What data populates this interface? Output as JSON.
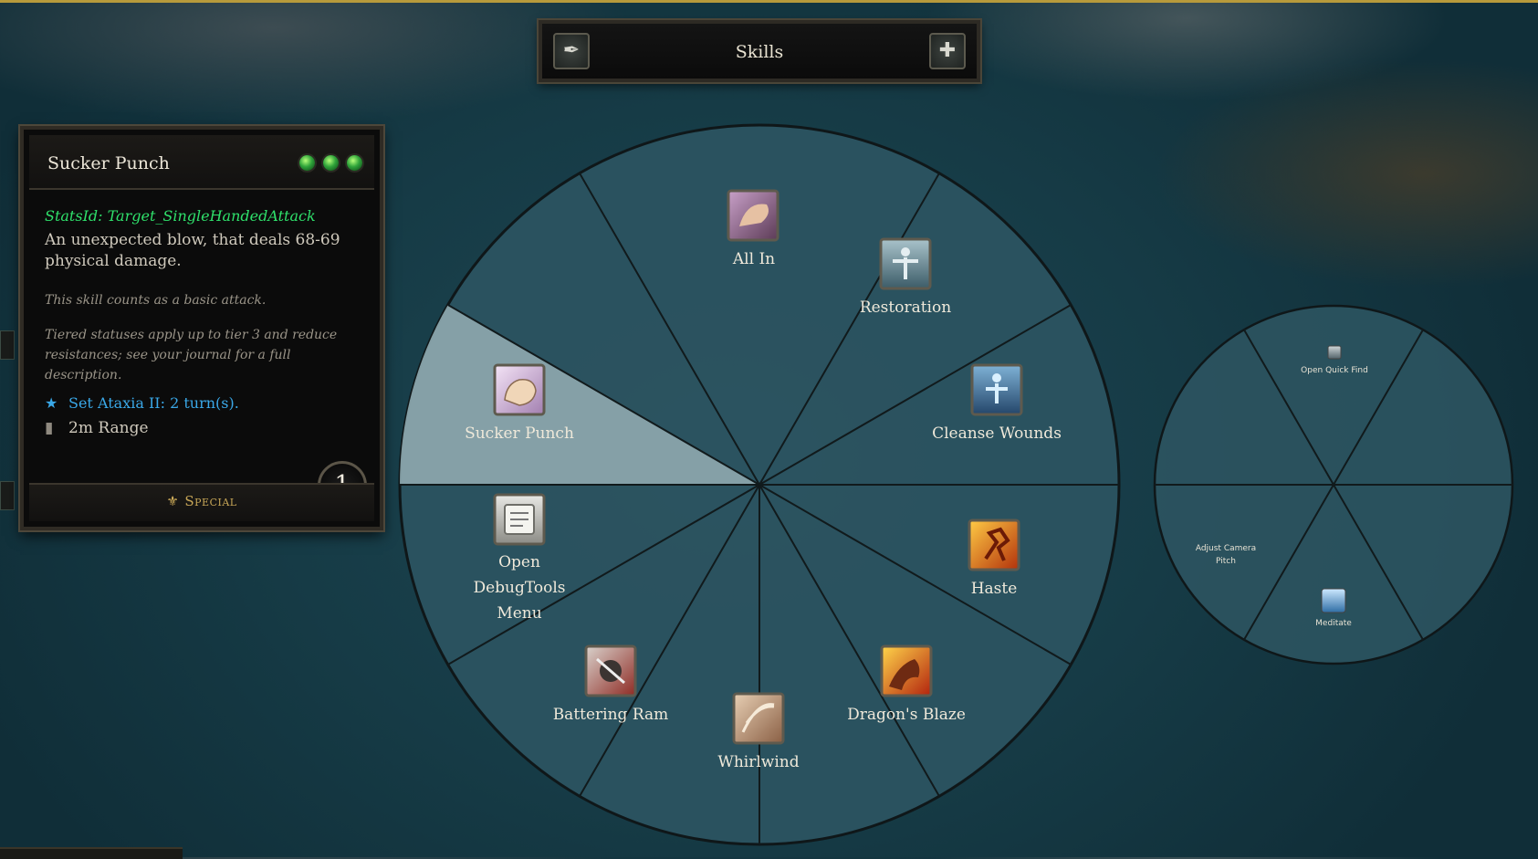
{
  "header": {
    "title": "Skills",
    "left_icon": "ink-quill-icon",
    "right_icon": "plus-cross-icon"
  },
  "tooltip": {
    "title": "Sucker Punch",
    "ap_orbs": 3,
    "stats_id": "StatsId: Target_SingleHandedAttack",
    "description": "An unexpected blow, that deals 68-69 physical damage.",
    "note_1": "This skill counts as a basic attack.",
    "note_2": "Tiered statuses apply up to tier 3 and reduce resistances; see your journal for a full description.",
    "status_effect": "Set Ataxia II: 2 turn(s).",
    "range": "2m Range",
    "school": "Special",
    "cooldown": "1",
    "colors": {
      "stats_id": "#2fe06b",
      "status": "#3aa8e8",
      "school": "#c7a657"
    }
  },
  "main_wheel": {
    "selected": "Sucker Punch",
    "items": [
      {
        "label": "All In",
        "icon": "fist-grab-icon"
      },
      {
        "label": "Restoration",
        "icon": "restoration-figure-icon"
      },
      {
        "label": "Cleanse Wounds",
        "icon": "cleanse-aura-icon"
      },
      {
        "label": "Haste",
        "icon": "haste-runner-icon"
      },
      {
        "label": "Dragon's Blaze",
        "icon": "dragon-fire-icon"
      },
      {
        "label": "Whirlwind",
        "icon": "whirlwind-slash-icon"
      },
      {
        "label": "Battering Ram",
        "icon": "battering-ram-icon"
      },
      {
        "label": "Open DebugTools Menu",
        "label_lines": [
          "Open",
          "DebugTools",
          "Menu"
        ],
        "icon": "scroll-icon"
      },
      {
        "label": "Sucker Punch",
        "icon": "punch-fist-icon"
      }
    ]
  },
  "secondary_wheel": {
    "items": [
      {
        "label": "Open Quick Find",
        "icon": "quick-find-icon"
      },
      {
        "label": "Adjust Camera Pitch",
        "label_lines": [
          "Adjust Camera",
          "Pitch"
        ],
        "icon": ""
      },
      {
        "label": "Meditate",
        "icon": "meditate-icon"
      }
    ]
  },
  "theme": {
    "wedge": "#2c5461",
    "wedge_selected": "#8aa4ab",
    "divider": "#111a1c",
    "accent_top": "#b79a3b"
  }
}
